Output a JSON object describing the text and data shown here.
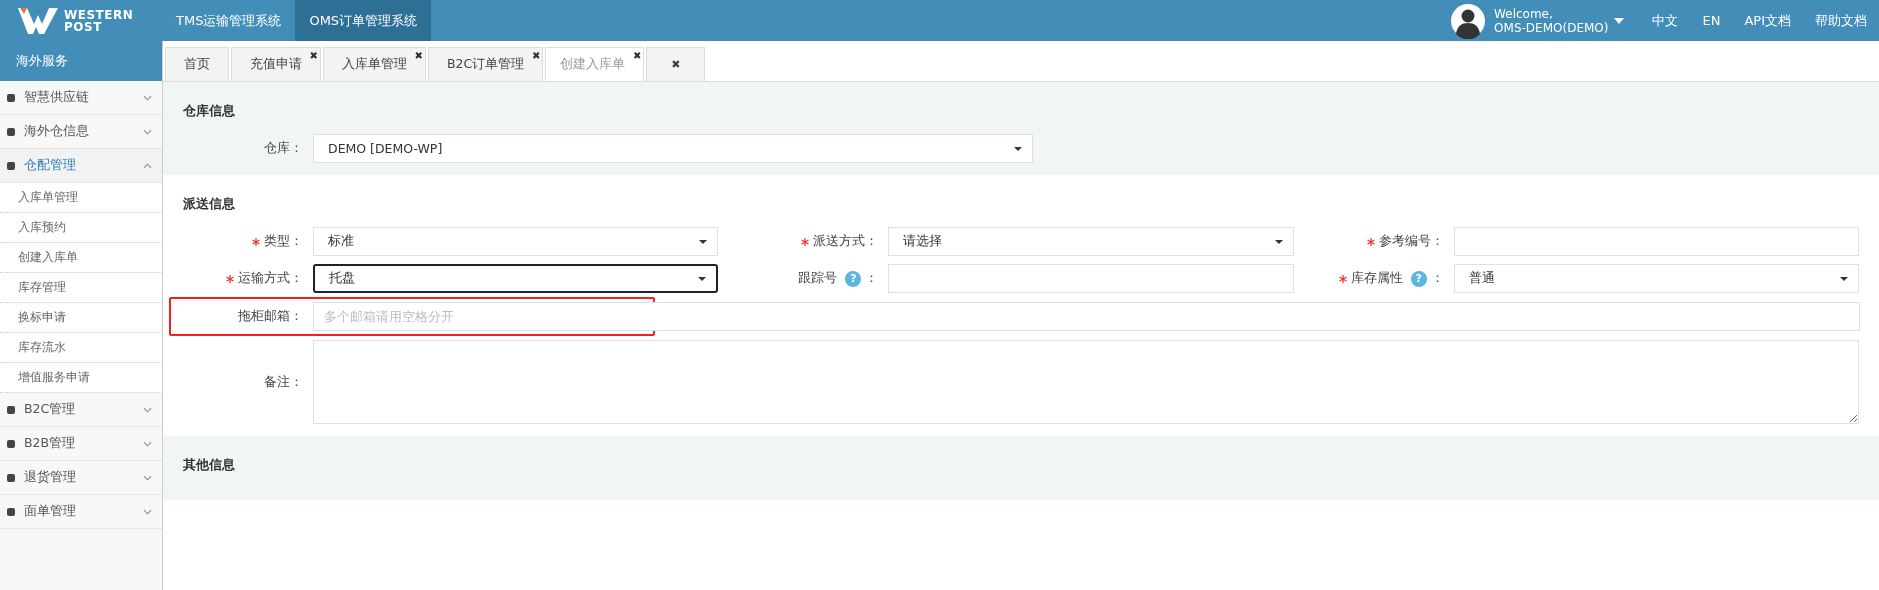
{
  "header": {
    "logo": {
      "line1": "WESTERN",
      "line2": "POST"
    },
    "systems": [
      {
        "label": "TMS运输管理系统",
        "selected": false
      },
      {
        "label": "OMS订单管理系统",
        "selected": true
      }
    ],
    "user": {
      "greeting": "Welcome,",
      "name": "OMS-DEMO(DEMO)"
    },
    "links": [
      "中文",
      "EN",
      "API文档",
      "帮助文档"
    ]
  },
  "sidebar": {
    "title": "海外服务",
    "groups": [
      {
        "label": "智慧供应链",
        "expanded": false
      },
      {
        "label": "海外仓信息",
        "expanded": false
      },
      {
        "label": "仓配管理",
        "expanded": true,
        "children": [
          "入库单管理",
          "入库预约",
          "创建入库单",
          "库存管理",
          "换标申请",
          "库存流水",
          "增值服务申请"
        ]
      },
      {
        "label": "B2C管理",
        "expanded": false
      },
      {
        "label": "B2B管理",
        "expanded": false
      },
      {
        "label": "退货管理",
        "expanded": false
      },
      {
        "label": "面单管理",
        "expanded": false
      }
    ]
  },
  "tabs": [
    {
      "label": "首页",
      "closable": false,
      "selected": false
    },
    {
      "label": "充值申请",
      "closable": true,
      "selected": false
    },
    {
      "label": "入库单管理",
      "closable": true,
      "selected": false
    },
    {
      "label": "B2C订单管理",
      "closable": true,
      "selected": false
    },
    {
      "label": "创建入库单",
      "closable": true,
      "selected": true
    }
  ],
  "close_mark": "✖",
  "close_all": "✖",
  "sections": [
    {
      "title": "仓库信息",
      "fields": [
        {
          "label": "仓库：",
          "kind": "wide_select",
          "required": false,
          "value": "DEMO [DEMO-WP]"
        }
      ]
    },
    {
      "title": "派送信息",
      "fields": [
        {
          "label": "类型：",
          "kind": "select",
          "required": true,
          "value": "标准"
        },
        {
          "label": "派送方式：",
          "kind": "select",
          "required": true,
          "value": "请选择"
        },
        {
          "label": "参考编号：",
          "kind": "input",
          "required": true
        },
        {
          "label": "运输方式：",
          "kind": "select",
          "required": true,
          "value": "托盘",
          "focused": true
        },
        {
          "label": "跟踪号",
          "help": "?",
          "suffix": "：",
          "kind": "input",
          "required": false
        },
        {
          "label": "库存属性",
          "help": "?",
          "suffix": "：",
          "kind": "select",
          "required": true,
          "value": "普通"
        },
        {
          "label": "拖柜邮箱：",
          "kind": "wide_input",
          "required": false,
          "placeholder": "多个邮箱请用空格分开",
          "highlighted": true
        },
        {
          "label": "备注：",
          "kind": "textarea",
          "required": false
        }
      ]
    },
    {
      "title": "其他信息"
    }
  ]
}
